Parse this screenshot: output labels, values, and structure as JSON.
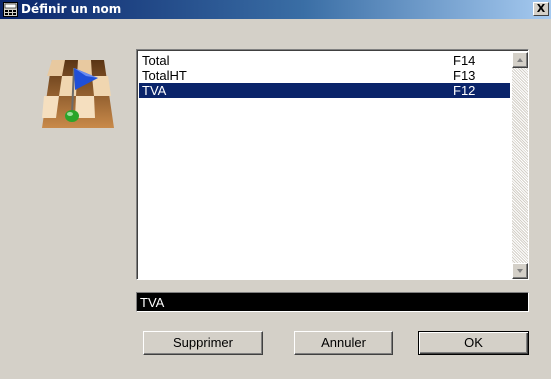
{
  "window": {
    "title": "Définir un nom",
    "close_label": "X",
    "title_icon": "calculator-icon"
  },
  "image": {
    "icon": "flag-checkerboard-icon"
  },
  "list": {
    "items": [
      {
        "name": "Total",
        "key": "F14",
        "selected": false
      },
      {
        "name": "TotalHT",
        "key": "F13",
        "selected": false
      },
      {
        "name": "TVA",
        "key": "F12",
        "selected": true
      }
    ]
  },
  "name_field": {
    "value": "TVA"
  },
  "buttons": {
    "delete": "Supprimer",
    "cancel": "Annuler",
    "ok": "OK"
  },
  "colors": {
    "selection": "#0a246a",
    "title_gradient_start": "#0a246a",
    "title_gradient_end": "#a6caf0",
    "face": "#d4d0c8"
  }
}
